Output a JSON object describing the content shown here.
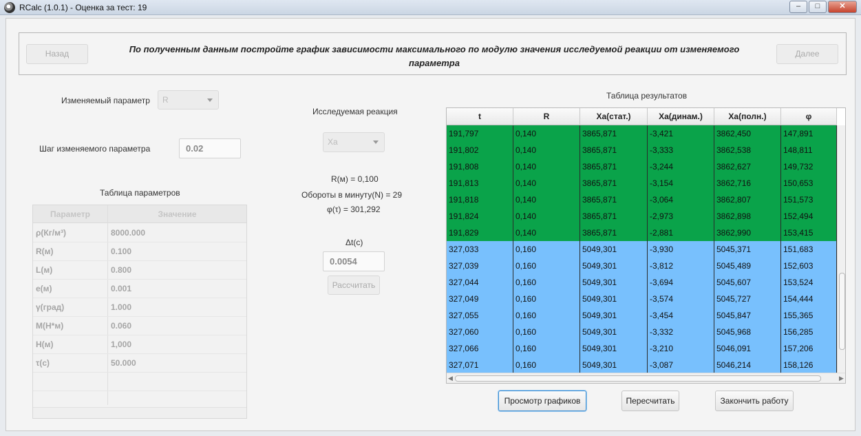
{
  "window": {
    "title": "RCalc (1.0.1) - Оценка за тест: 19",
    "minimize_glyph": "–",
    "maximize_glyph": "□",
    "close_glyph": "✕"
  },
  "header": {
    "back_label": "Назад",
    "next_label": "Далее",
    "question": "По полученным данным постройте график зависимости максимального по модулю значения исследуемой реакции от изменяемого параметра"
  },
  "left": {
    "param_label": "Изменяемый параметр",
    "param_value": "R",
    "step_label": "Шаг изменяемого параметра",
    "step_value": "0.02",
    "params_title": "Таблица параметров",
    "params_columns": [
      "Параметр",
      "Значение"
    ],
    "params_rows": [
      [
        "ρ(Кг/м³)",
        "8000.000"
      ],
      [
        "R(м)",
        "0.100"
      ],
      [
        "L(м)",
        "0.800"
      ],
      [
        "e(м)",
        "0.001"
      ],
      [
        "γ(град)",
        "1.000"
      ],
      [
        "M(H*м)",
        "0.060"
      ],
      [
        "H(м)",
        "1,000"
      ],
      [
        "τ(c)",
        "50.000"
      ],
      [
        "",
        ""
      ],
      [
        "",
        ""
      ]
    ]
  },
  "middle": {
    "reaction_label": "Исследуемая реакция",
    "reaction_value": "Xa",
    "r_line": "R(м)  =  0,100",
    "rpm_line": "Обороты в минуту(N)  =  29",
    "phi_line": "φ(τ)  =  301,292",
    "dt_label": "Δt(c)",
    "dt_value": "0.0054",
    "calc_label": "Рассчитать"
  },
  "results": {
    "title": "Таблица результатов",
    "columns": [
      "t",
      "R",
      "Xa(стат.)",
      "Xa(динам.)",
      "Xa(полн.)",
      "φ"
    ],
    "rows": [
      {
        "group": "green",
        "cells": [
          "191,797",
          "0,140",
          "3865,871",
          "-3,421",
          "3862,450",
          "147,891"
        ]
      },
      {
        "group": "green",
        "cells": [
          "191,802",
          "0,140",
          "3865,871",
          "-3,333",
          "3862,538",
          "148,811"
        ]
      },
      {
        "group": "green",
        "cells": [
          "191,808",
          "0,140",
          "3865,871",
          "-3,244",
          "3862,627",
          "149,732"
        ]
      },
      {
        "group": "green",
        "cells": [
          "191,813",
          "0,140",
          "3865,871",
          "-3,154",
          "3862,716",
          "150,653"
        ]
      },
      {
        "group": "green",
        "cells": [
          "191,818",
          "0,140",
          "3865,871",
          "-3,064",
          "3862,807",
          "151,573"
        ]
      },
      {
        "group": "green",
        "cells": [
          "191,824",
          "0,140",
          "3865,871",
          "-2,973",
          "3862,898",
          "152,494"
        ]
      },
      {
        "group": "green",
        "cells": [
          "191,829",
          "0,140",
          "3865,871",
          "-2,881",
          "3862,990",
          "153,415"
        ]
      },
      {
        "group": "blue",
        "cells": [
          "327,033",
          "0,160",
          "5049,301",
          "-3,930",
          "5045,371",
          "151,683"
        ]
      },
      {
        "group": "blue",
        "cells": [
          "327,039",
          "0,160",
          "5049,301",
          "-3,812",
          "5045,489",
          "152,603"
        ]
      },
      {
        "group": "blue",
        "cells": [
          "327,044",
          "0,160",
          "5049,301",
          "-3,694",
          "5045,607",
          "153,524"
        ]
      },
      {
        "group": "blue",
        "cells": [
          "327,049",
          "0,160",
          "5049,301",
          "-3,574",
          "5045,727",
          "154,444"
        ]
      },
      {
        "group": "blue",
        "cells": [
          "327,055",
          "0,160",
          "5049,301",
          "-3,454",
          "5045,847",
          "155,365"
        ]
      },
      {
        "group": "blue",
        "cells": [
          "327,060",
          "0,160",
          "5049,301",
          "-3,332",
          "5045,968",
          "156,285"
        ]
      },
      {
        "group": "blue",
        "cells": [
          "327,066",
          "0,160",
          "5049,301",
          "-3,210",
          "5046,091",
          "157,206"
        ]
      },
      {
        "group": "blue",
        "cells": [
          "327,071",
          "0,160",
          "5049,301",
          "-3,087",
          "5046,214",
          "158,126"
        ]
      }
    ],
    "row_colors": {
      "green": "#0aa34a",
      "blue": "#78c0fd"
    }
  },
  "footer": {
    "view_charts_label": "Просмотр графиков",
    "recalc_label": "Пересчитать",
    "finish_label": "Закончить работу"
  }
}
